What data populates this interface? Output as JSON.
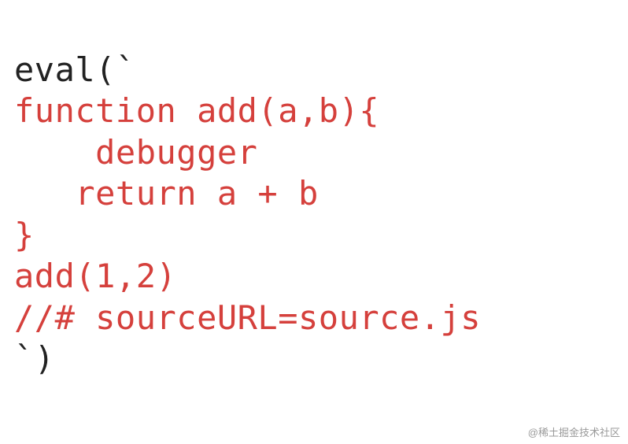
{
  "code": {
    "line1_black": "eval(`",
    "line2_red": "function add(a,b){",
    "line3_red": "    debugger",
    "line4_red": "   return a + b",
    "line5_red": "}",
    "line6_red": "add(1,2)",
    "line7_red": "//# sourceURL=source.js",
    "line8_black": "`)"
  },
  "watermark": "@稀土掘金技术社区"
}
